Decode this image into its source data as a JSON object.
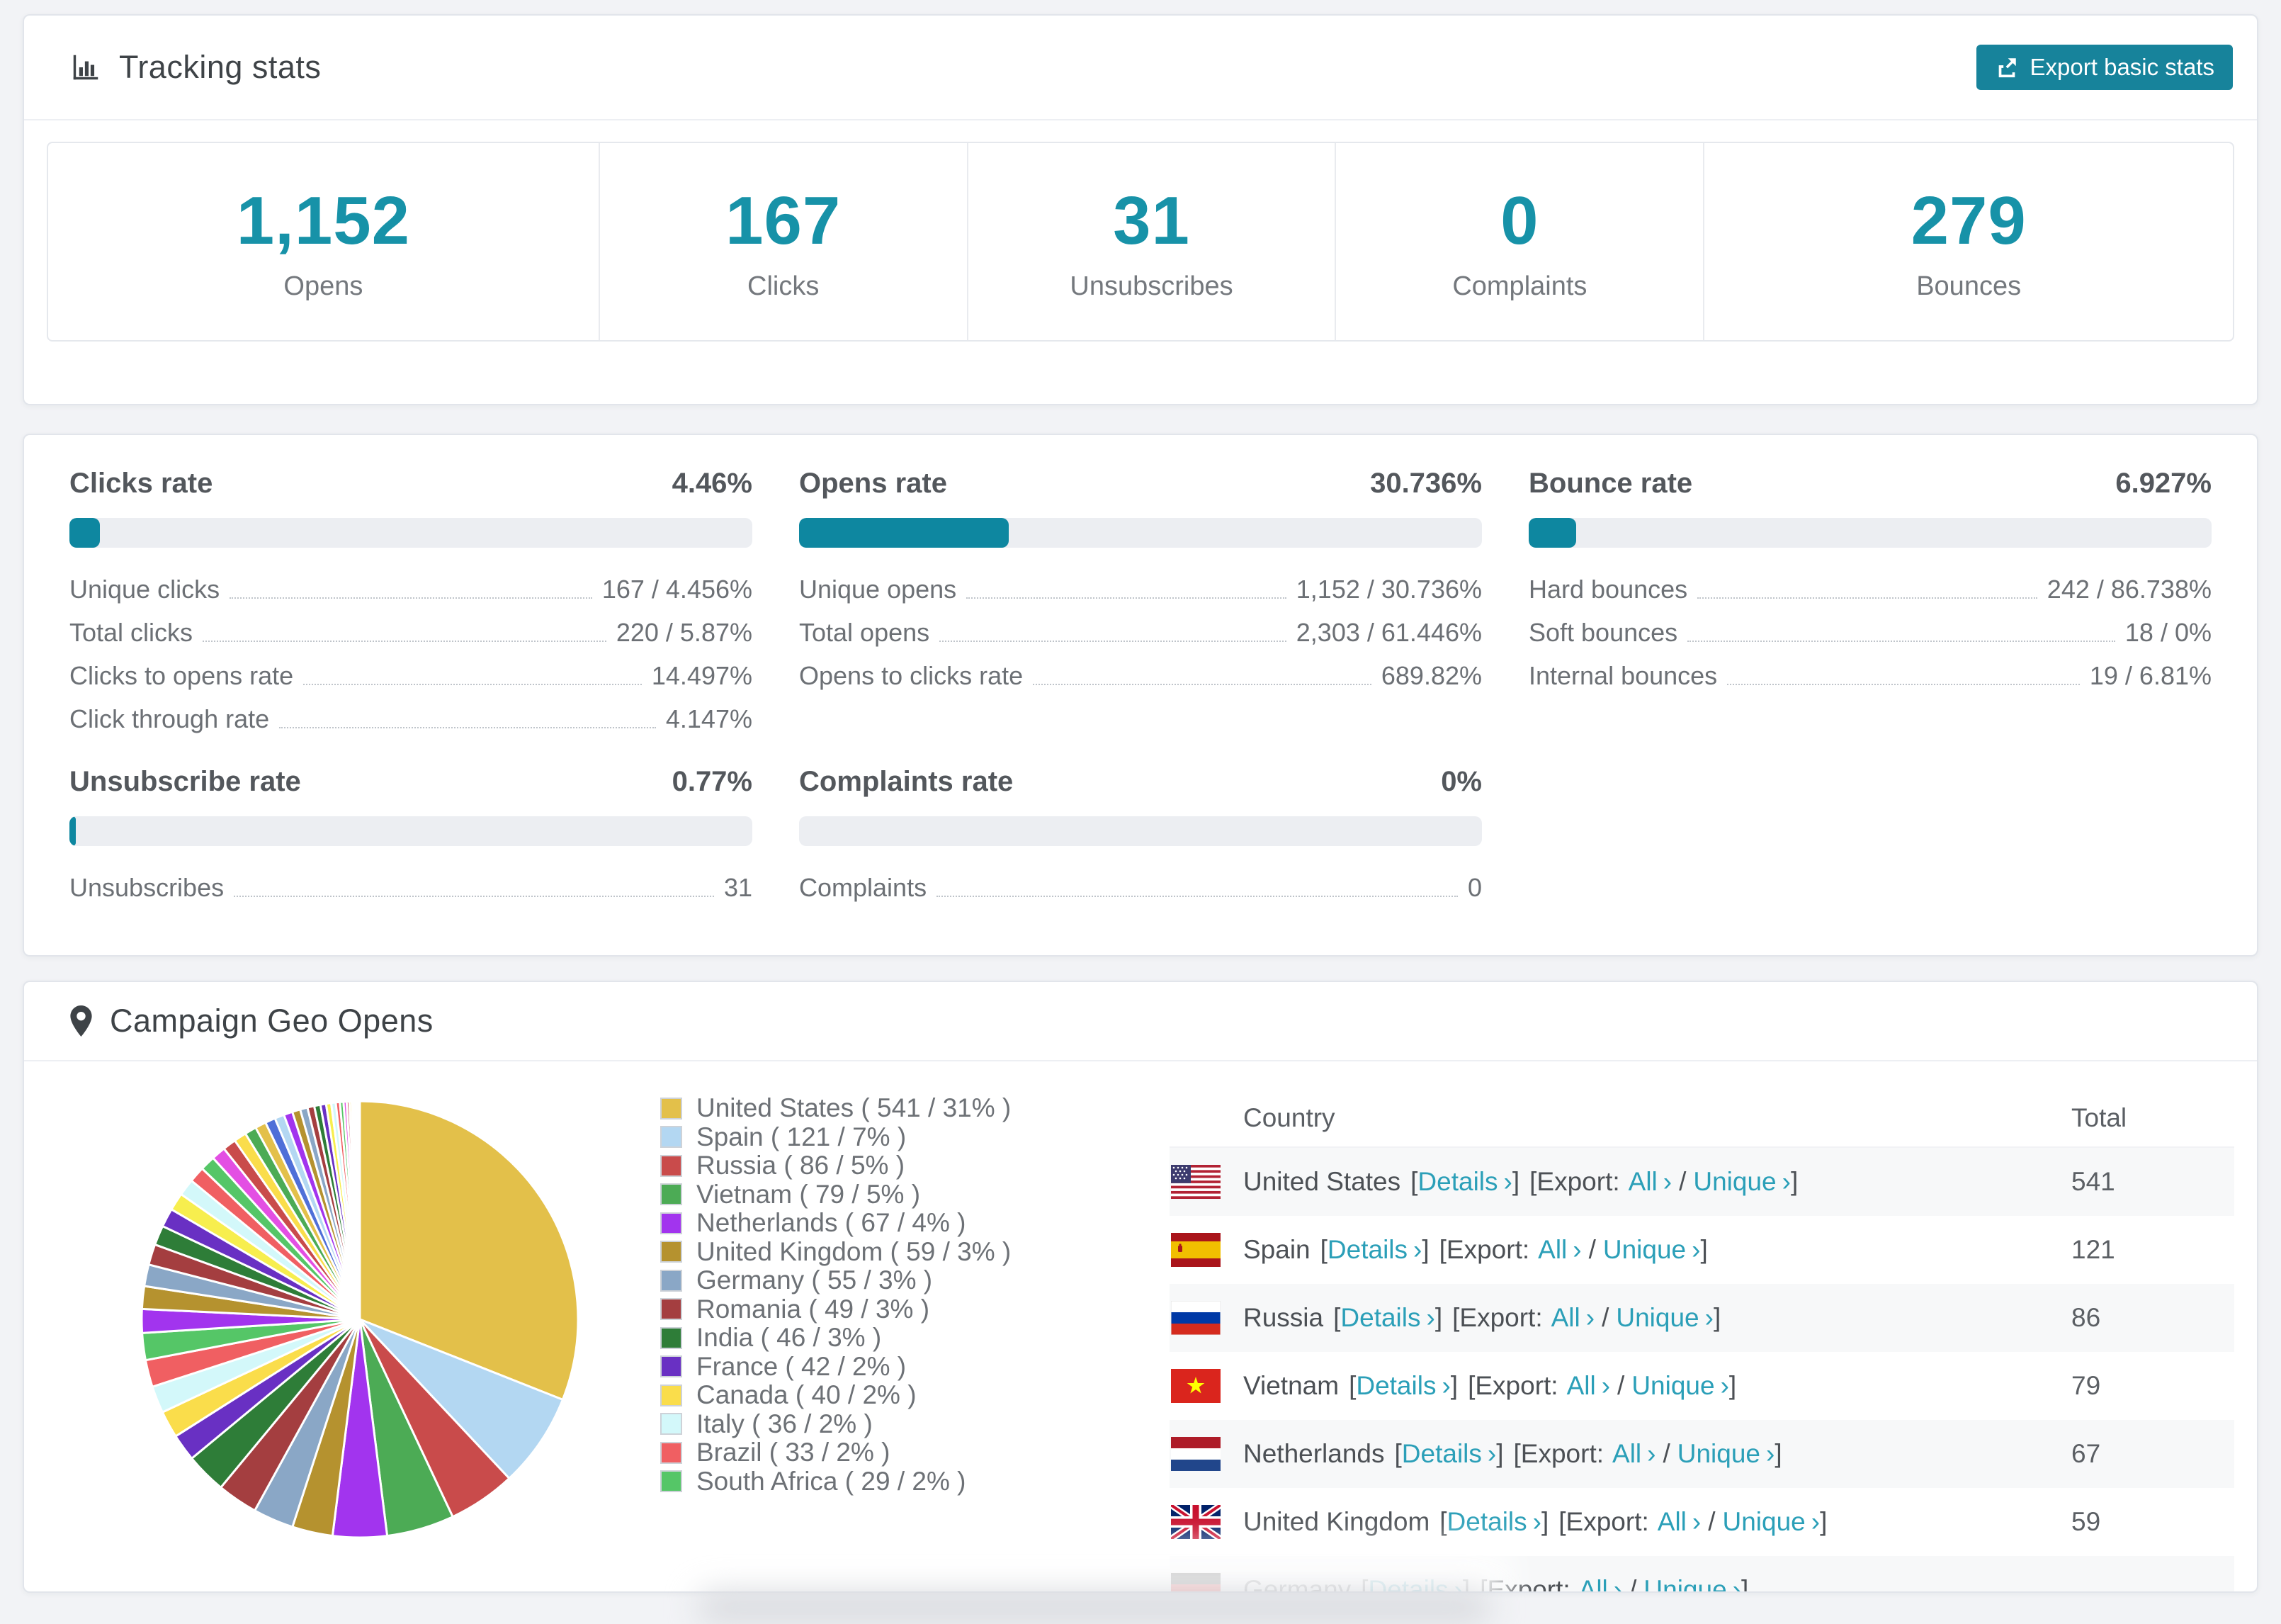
{
  "page": {
    "background": "#f2f3f6"
  },
  "colors": {
    "accent_teal": "#1792a8",
    "link_teal": "#2b9fb8",
    "button_teal": "#17839b",
    "bar_fill": "#0e87a0",
    "bar_track": "#eceef2"
  },
  "tracking": {
    "title": "Tracking stats",
    "export_button_label": "Export basic stats"
  },
  "summary": [
    {
      "value": "1,152",
      "label": "Opens"
    },
    {
      "value": "167",
      "label": "Clicks"
    },
    {
      "value": "31",
      "label": "Unsubscribes"
    },
    {
      "value": "0",
      "label": "Complaints"
    },
    {
      "value": "279",
      "label": "Bounces"
    }
  ],
  "rates": [
    {
      "title": "Clicks rate",
      "display": "4.46%",
      "pct": 4.46,
      "rows": [
        {
          "label": "Unique clicks",
          "value": "167 / 4.456%"
        },
        {
          "label": "Total clicks",
          "value": "220 / 5.87%"
        },
        {
          "label": "Clicks to opens rate",
          "value": "14.497%"
        },
        {
          "label": "Click through rate",
          "value": "4.147%"
        }
      ]
    },
    {
      "title": "Opens rate",
      "display": "30.736%",
      "pct": 30.736,
      "rows": [
        {
          "label": "Unique opens",
          "value": "1,152 / 30.736%"
        },
        {
          "label": "Total opens",
          "value": "2,303 / 61.446%"
        },
        {
          "label": "Opens to clicks rate",
          "value": "689.82%"
        }
      ]
    },
    {
      "title": "Bounce rate",
      "display": "6.927%",
      "pct": 6.927,
      "rows": [
        {
          "label": "Hard bounces",
          "value": "242 / 86.738%"
        },
        {
          "label": "Soft bounces",
          "value": "18 / 0%"
        },
        {
          "label": "Internal bounces",
          "value": "19 / 6.81%"
        }
      ]
    },
    {
      "title": "Unsubscribe rate",
      "display": "0.77%",
      "pct": 0.77,
      "rows": [
        {
          "label": "Unsubscribes",
          "value": "31"
        }
      ]
    },
    {
      "title": "Complaints rate",
      "display": "0%",
      "pct": 0,
      "rows": [
        {
          "label": "Complaints",
          "value": "0"
        }
      ]
    }
  ],
  "geo": {
    "title": "Campaign Geo Opens",
    "legend": [
      "United States ( 541 / 31% )",
      "Spain ( 121 / 7% )",
      "Russia ( 86 / 5% )",
      "Vietnam ( 79 / 5% )",
      "Netherlands ( 67 / 4% )",
      "United Kingdom ( 59 / 3% )",
      "Germany ( 55 / 3% )",
      "Romania ( 49 / 3% )",
      "India ( 46 / 3% )",
      "France ( 42 / 2% )",
      "Canada ( 40 / 2% )",
      "Italy ( 36 / 2% )",
      "Brazil ( 33 / 2% )",
      "South Africa ( 29 / 2% )"
    ],
    "table": {
      "columns": [
        "Country",
        "Total"
      ],
      "tokens": {
        "open": "[",
        "close": "]",
        "chev": "›",
        "slash": "/",
        "details": "Details",
        "export": "Export:",
        "all": "All",
        "unique": "Unique"
      },
      "rows": [
        {
          "country": "United States",
          "total": "541",
          "flag": "us"
        },
        {
          "country": "Spain",
          "total": "121",
          "flag": "es"
        },
        {
          "country": "Russia",
          "total": "86",
          "flag": "ru"
        },
        {
          "country": "Vietnam",
          "total": "79",
          "flag": "vn"
        },
        {
          "country": "Netherlands",
          "total": "67",
          "flag": "nl"
        },
        {
          "country": "United Kingdom",
          "total": "59",
          "flag": "gb"
        },
        {
          "country": "Germany",
          "total": "",
          "flag": "de"
        }
      ]
    }
  },
  "chart_data": {
    "type": "pie",
    "title": "Campaign Geo Opens",
    "value_unit": "opens",
    "start_angle_deg": -90,
    "direction": "clockwise",
    "slice_border_color": "#ffffff",
    "series": [
      {
        "label": "United States",
        "value": 541,
        "pct": 31,
        "color": "#e3c04a"
      },
      {
        "label": "Spain",
        "value": 121,
        "pct": 7,
        "color": "#b3d7f2"
      },
      {
        "label": "Russia",
        "value": 86,
        "pct": 5,
        "color": "#c94b4b"
      },
      {
        "label": "Vietnam",
        "value": 79,
        "pct": 5,
        "color": "#4cab55"
      },
      {
        "label": "Netherlands",
        "value": 67,
        "pct": 4,
        "color": "#a234ee"
      },
      {
        "label": "United Kingdom",
        "value": 59,
        "pct": 3,
        "color": "#b5922f"
      },
      {
        "label": "Germany",
        "value": 55,
        "pct": 3,
        "color": "#8aa7c6"
      },
      {
        "label": "Romania",
        "value": 49,
        "pct": 3,
        "color": "#a43e40"
      },
      {
        "label": "India",
        "value": 46,
        "pct": 3,
        "color": "#2e7d38"
      },
      {
        "label": "France",
        "value": 42,
        "pct": 2,
        "color": "#6930c3"
      },
      {
        "label": "Canada",
        "value": 40,
        "pct": 2,
        "color": "#fadd4b"
      },
      {
        "label": "Italy",
        "value": 36,
        "pct": 2,
        "color": "#d3f8fa"
      },
      {
        "label": "Brazil",
        "value": 33,
        "pct": 2,
        "color": "#f05f62"
      },
      {
        "label": "South Africa",
        "value": 29,
        "pct": 2,
        "color": "#55c667"
      }
    ],
    "unlabeled_tail": {
      "note": "many small unlabeled country slices",
      "total_pct": 26,
      "slice_count": 40
    },
    "tail_palette": [
      "#a234ee",
      "#b5922f",
      "#8aa7c6",
      "#a43e40",
      "#2e7d38",
      "#6930c3",
      "#f7ee4e",
      "#d3f8fa",
      "#f05f62",
      "#55c667",
      "#e34fe3",
      "#c94b4b",
      "#fadd4b",
      "#4cab55",
      "#e3c04a",
      "#4f6fd8",
      "#b3d7f2"
    ]
  }
}
